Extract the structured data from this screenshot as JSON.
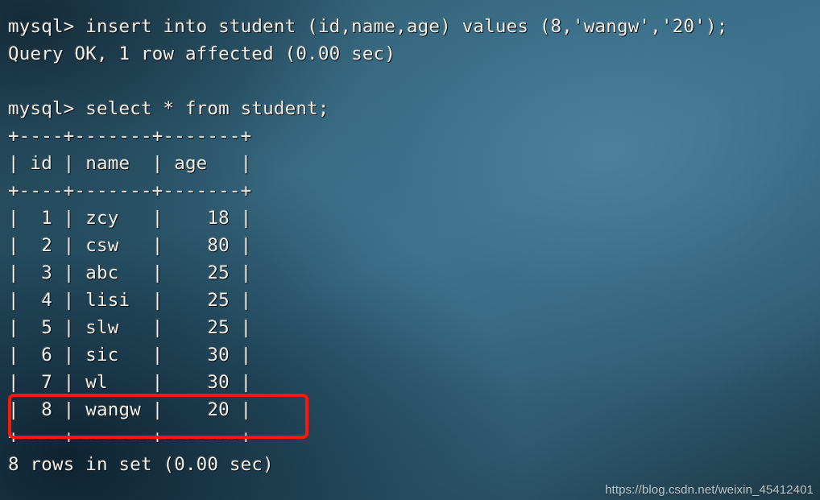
{
  "terminal": {
    "prompt": "mysql>",
    "colors": {
      "background": "#376a85",
      "background_dark": "#1d3947",
      "text": "#f2f1ea",
      "highlight": "#fc1808",
      "watermark": "#cfd4d8"
    },
    "lines": [
      "mysql> insert into student (id,name,age) values (8,'wangw','20');",
      "Query OK, 1 row affected (0.00 sec)",
      "",
      "mysql> select * from student;",
      "+----+-------+-------+",
      "| id | name  | age   |",
      "+----+-------+-------+",
      "|  1 | zcy   |    18 |",
      "|  2 | csw   |    80 |",
      "|  3 | abc   |    25 |",
      "|  4 | lisi  |    25 |",
      "|  5 | slw   |    25 |",
      "|  6 | sic   |    30 |",
      "|  7 | wl    |    30 |",
      "|  8 | wangw |    20 |",
      "+----+-------+-------+",
      "8 rows in set (0.00 sec)"
    ],
    "commands": [
      {
        "statement": "insert into student (id,name,age) values (8,'wangw','20');",
        "result": "Query OK, 1 row affected (0.00 sec)"
      },
      {
        "statement": "select * from student;",
        "result": "8 rows in set (0.00 sec)"
      }
    ],
    "result_table": {
      "columns": [
        "id",
        "name",
        "age"
      ],
      "rows": [
        [
          "1",
          "zcy",
          "18"
        ],
        [
          "2",
          "csw",
          "80"
        ],
        [
          "3",
          "abc",
          "25"
        ],
        [
          "4",
          "lisi",
          "25"
        ],
        [
          "5",
          "slw",
          "25"
        ],
        [
          "6",
          "sic",
          "30"
        ],
        [
          "7",
          "wl",
          "30"
        ],
        [
          "8",
          "wangw",
          "20"
        ]
      ],
      "row_count": "8 rows in set (0.00 sec)",
      "highlighted_row_index": 7
    }
  },
  "annotation": {
    "label": "highlight-row-8"
  },
  "watermark": {
    "text": "https://blog.csdn.net/weixin_45412401"
  }
}
